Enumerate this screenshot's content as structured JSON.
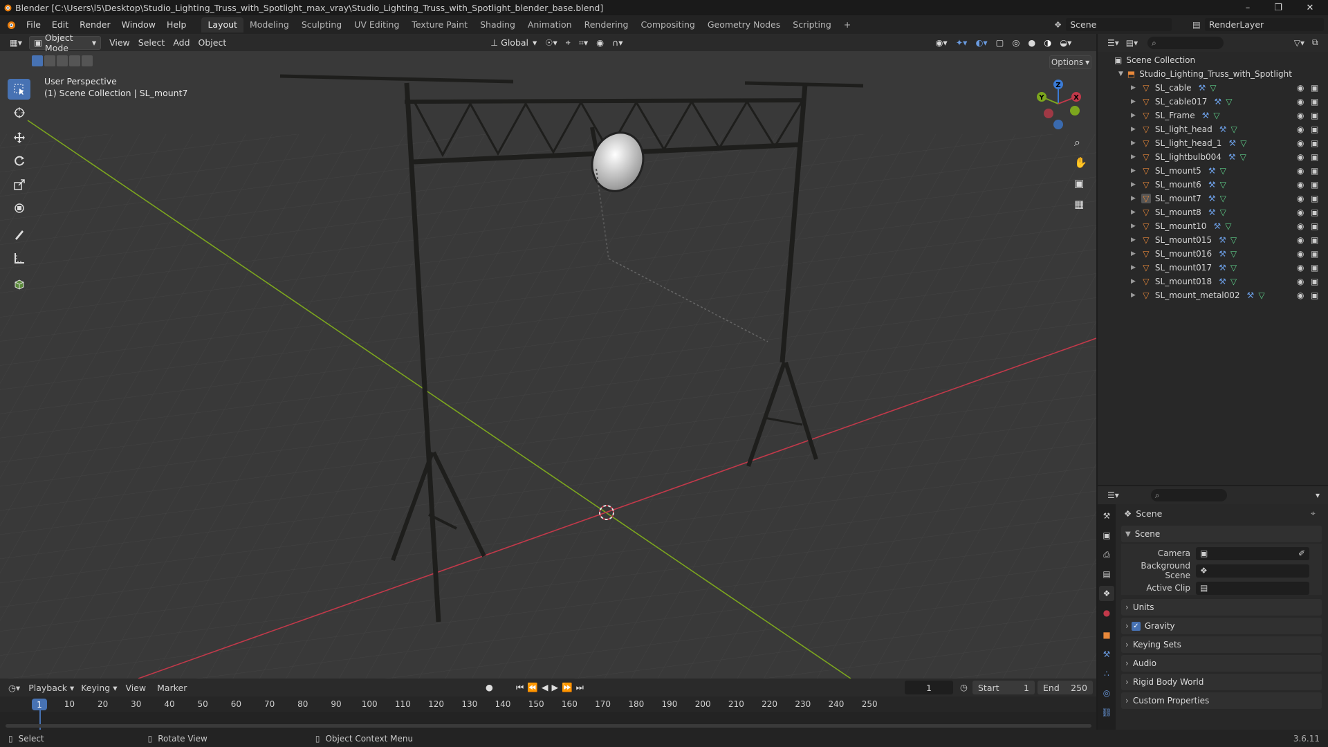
{
  "title_bar": {
    "text": "Blender [C:\\Users\\l5\\Desktop\\Studio_Lighting_Truss_with_Spotlight_max_vray\\Studio_Lighting_Truss_with_Spotlight_blender_base.blend]"
  },
  "menu": [
    "File",
    "Edit",
    "Render",
    "Window",
    "Help"
  ],
  "workspaces": [
    "Layout",
    "Modeling",
    "Sculpting",
    "UV Editing",
    "Texture Paint",
    "Shading",
    "Animation",
    "Rendering",
    "Compositing",
    "Geometry Nodes",
    "Scripting"
  ],
  "active_workspace": "Layout",
  "scene_selector": {
    "label": "Scene"
  },
  "view_layer": {
    "label": "RenderLayer"
  },
  "viewport_header": {
    "mode": "Object Mode",
    "menus": [
      "View",
      "Select",
      "Add",
      "Object"
    ],
    "transform_orientation": "Global",
    "options_label": "Options"
  },
  "viewport": {
    "perspective_label": "User Perspective",
    "context_label": "(1) Scene Collection | SL_mount7"
  },
  "tools": [
    "select-box",
    "cursor",
    "move",
    "rotate",
    "scale",
    "transform",
    "annotate",
    "measure",
    "add-cube"
  ],
  "outliner": {
    "root": "Scene Collection",
    "collection": "Studio_Lighting_Truss_with_Spotlight",
    "objects": [
      "SL_cable",
      "SL_cable017",
      "SL_Frame",
      "SL_light_head",
      "SL_light_head_1",
      "SL_lightbulb004",
      "SL_mount5",
      "SL_mount6",
      "SL_mount7",
      "SL_mount8",
      "SL_mount10",
      "SL_mount015",
      "SL_mount016",
      "SL_mount017",
      "SL_mount018",
      "SL_mount_metal002"
    ],
    "active_object": "SL_mount7"
  },
  "properties": {
    "header": "Scene",
    "scene_panel": "Scene",
    "fields": [
      {
        "label": "Camera",
        "value": ""
      },
      {
        "label": "Background Scene",
        "value": ""
      },
      {
        "label": "Active Clip",
        "value": ""
      }
    ],
    "collapsed_panels": [
      "Units",
      "Gravity",
      "Keying Sets",
      "Audio",
      "Rigid Body World",
      "Custom Properties"
    ],
    "gravity_checked": true
  },
  "timeline": {
    "menus": [
      "Playback",
      "Keying",
      "View",
      "Marker"
    ],
    "current_frame": "1",
    "start_label": "Start",
    "start": "1",
    "end_label": "End",
    "end": "250",
    "ruler_ticks": [
      "10",
      "20",
      "30",
      "40",
      "50",
      "60",
      "70",
      "80",
      "90",
      "100",
      "110",
      "120",
      "130",
      "140",
      "150",
      "160",
      "170",
      "180",
      "190",
      "200",
      "210",
      "220",
      "230",
      "240",
      "250"
    ],
    "ruler_current": "1"
  },
  "status_bar": {
    "items": [
      "Select",
      "Rotate View",
      "Object Context Menu"
    ],
    "version": "3.6.11"
  },
  "colors": {
    "accent": "#4772b3",
    "x_axis": "#c2394a",
    "y_axis": "#7ca61e",
    "z_axis": "#3b7bd6",
    "object_icon": "#e8883a"
  }
}
